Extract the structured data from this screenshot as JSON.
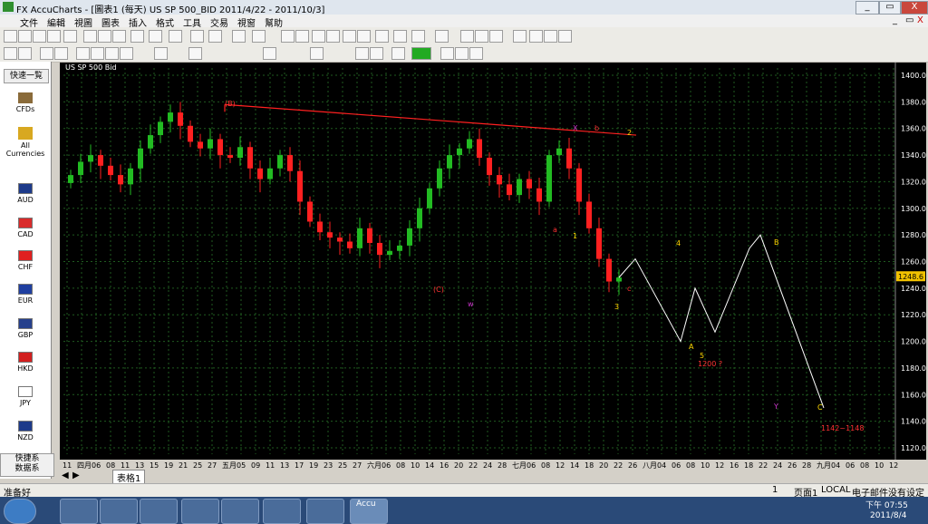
{
  "window": {
    "title": "FX AccuCharts - [圖表1 (每天)  US SP 500_BID 2011/4/22 - 2011/10/3]",
    "minimize": "_",
    "restore": "▭",
    "close": "X",
    "mdi_minimize": "_",
    "mdi_restore": "▭",
    "mdi_close": "X"
  },
  "menu": [
    "文件",
    "編輯",
    "視圖",
    "圖表",
    "插入",
    "格式",
    "工具",
    "交易",
    "視窗",
    "幫助"
  ],
  "sidebar": {
    "header": "快速一覧",
    "items": [
      {
        "label": "CFDs",
        "icon": "bank-icon"
      },
      {
        "label": "All Currencies",
        "icon": "coins-icon"
      },
      {
        "label": "AUD",
        "icon": "flag-aud-icon"
      },
      {
        "label": "CAD",
        "icon": "flag-cad-icon"
      },
      {
        "label": "CHF",
        "icon": "flag-chf-icon"
      },
      {
        "label": "EUR",
        "icon": "flag-eur-icon"
      },
      {
        "label": "GBP",
        "icon": "flag-gbp-icon"
      },
      {
        "label": "HKD",
        "icon": "flag-hkd-icon"
      },
      {
        "label": "JPY",
        "icon": "flag-jpy-icon"
      },
      {
        "label": "NZD",
        "icon": "flag-nzd-icon"
      }
    ],
    "footer_line1": "快捷系",
    "footer_line2": "数据系"
  },
  "chart": {
    "title": "US SP 500 Bid",
    "price_tag": "1248.6",
    "y_ticks": [
      "1400.0",
      "1380.0",
      "1360.0",
      "1340.0",
      "1320.0",
      "1300.0",
      "1280.0",
      "1260.0",
      "1240.0",
      "1220.0",
      "1200.0",
      "1180.0",
      "1160.0",
      "1140.0",
      "1120.0"
    ],
    "x_ticks": [
      "11",
      "四月",
      "06",
      "08",
      "11",
      "13",
      "15",
      "19",
      "21",
      "25",
      "27",
      "五月",
      "05",
      "09",
      "11",
      "13",
      "17",
      "19",
      "23",
      "25",
      "27",
      "六月",
      "06",
      "08",
      "10",
      "14",
      "16",
      "20",
      "22",
      "24",
      "28",
      "七月",
      "06",
      "08",
      "12",
      "14",
      "18",
      "20",
      "22",
      "26",
      "八月",
      "04",
      "06",
      "08",
      "10",
      "12",
      "16",
      "18",
      "22",
      "24",
      "26",
      "28",
      "九月",
      "04",
      "06",
      "08",
      "10",
      "12"
    ],
    "annotations": [
      {
        "text": "(B)",
        "color": "#ff3333"
      },
      {
        "text": "(C)",
        "color": "#ff3333"
      },
      {
        "text": "w",
        "color": "#cc33cc"
      },
      {
        "text": "X",
        "color": "#cc33cc"
      },
      {
        "text": "b",
        "color": "#ff3333"
      },
      {
        "text": "2",
        "color": "#ffd700"
      },
      {
        "text": "a",
        "color": "#ff3333"
      },
      {
        "text": "1",
        "color": "#ffd700"
      },
      {
        "text": "4",
        "color": "#ffd700"
      },
      {
        "text": "c",
        "color": "#ff3333"
      },
      {
        "text": "3",
        "color": "#ffd700"
      },
      {
        "text": "A",
        "color": "#ffd700"
      },
      {
        "text": "5",
        "color": "#ffd700"
      },
      {
        "text": "1200 ?",
        "color": "#ff3333"
      },
      {
        "text": "B",
        "color": "#ffd700"
      },
      {
        "text": "Y",
        "color": "#cc33cc"
      },
      {
        "text": "C",
        "color": "#ffd700"
      },
      {
        "text": "1142~1148",
        "color": "#ff3333"
      }
    ],
    "colors": {
      "up": "#22bb22",
      "down": "#ff2020",
      "grid": "#1f5a1f",
      "trend": "#ff2020",
      "projection": "#ffffff"
    }
  },
  "chart_data": {
    "type": "candlestick",
    "title": "US SP 500 Bid",
    "ylim": [
      1110,
      1410
    ],
    "approx_closes": [
      1325,
      1335,
      1340,
      1332,
      1325,
      1318,
      1330,
      1345,
      1355,
      1365,
      1372,
      1362,
      1350,
      1345,
      1352,
      1340,
      1338,
      1346,
      1330,
      1322,
      1330,
      1340,
      1328,
      1305,
      1290,
      1282,
      1278,
      1275,
      1270,
      1285,
      1274,
      1265,
      1268,
      1272,
      1285,
      1300,
      1315,
      1330,
      1340,
      1345,
      1352,
      1338,
      1325,
      1318,
      1310,
      1322,
      1315,
      1305,
      1340,
      1345,
      1330,
      1305,
      1285,
      1262,
      1245,
      1248
    ],
    "projection": [
      1248,
      1262,
      1200,
      1240,
      1207,
      1270,
      1280,
      1150
    ],
    "trendline": [
      1378,
      1355
    ]
  },
  "tabs": {
    "active": "表格1"
  },
  "status": {
    "left": "准备好",
    "page": "1",
    "page_label": "页面1",
    "local": "LOCAL",
    "mail": "电子邮件没有设定"
  },
  "taskbar": {
    "time": "下午 07:55",
    "date": "2011/8/4",
    "app_label": "Accu"
  }
}
